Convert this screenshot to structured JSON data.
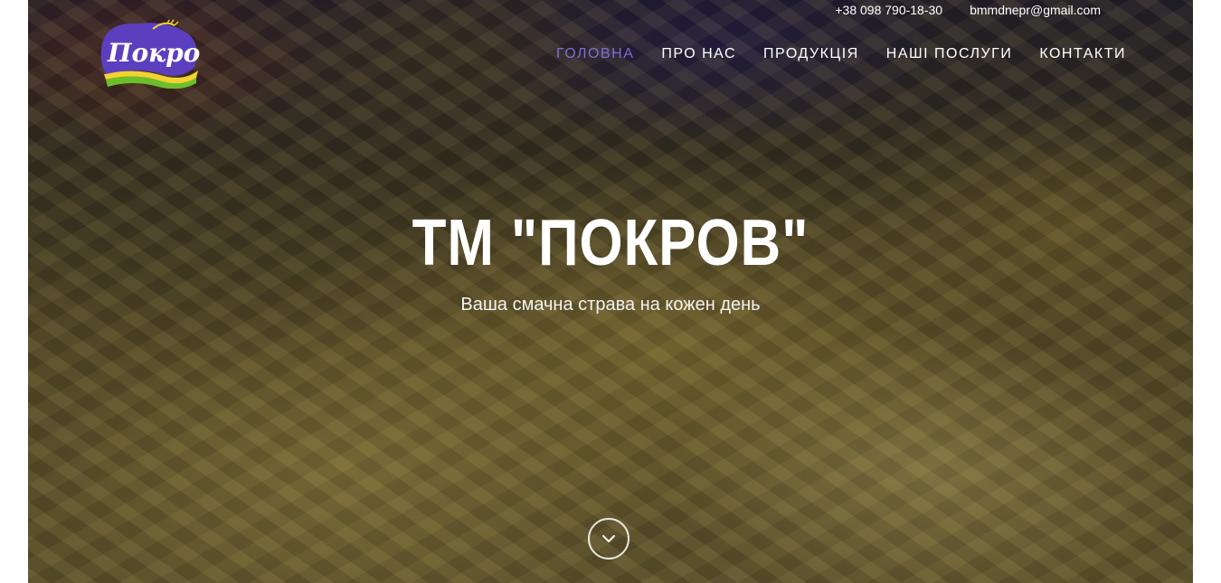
{
  "topbar": {
    "phone": "+38 098 790-18-30",
    "email": "bmmdnepr@gmail.com"
  },
  "logo": {
    "text": "Покров"
  },
  "nav": {
    "items": [
      {
        "label": "ГОЛОВНА",
        "active": true
      },
      {
        "label": "ПРО НАС",
        "active": false
      },
      {
        "label": "ПРОДУКЦІЯ",
        "active": false
      },
      {
        "label": "НАШІ ПОСЛУГИ",
        "active": false
      },
      {
        "label": "КОНТАКТИ",
        "active": false
      }
    ]
  },
  "hero": {
    "title": "ТМ \"ПОКРОВ\"",
    "subtitle": "Ваша смачна страва на кожен день",
    "scroll_icon": "chevron-down-icon"
  },
  "colors": {
    "accent": "#7b6fd6",
    "text": "#ffffff",
    "logo_purple": "#5b3fbf",
    "logo_yellow": "#f2d230",
    "logo_green": "#6cbf2a"
  }
}
